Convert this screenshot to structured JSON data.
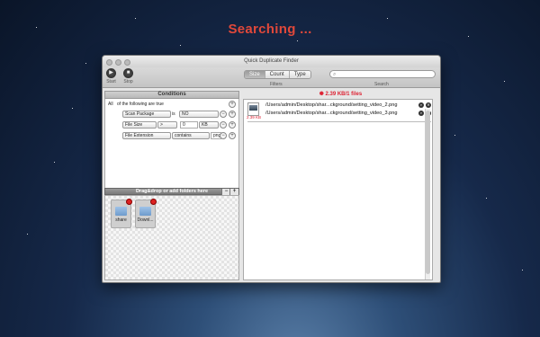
{
  "headline": "Searching ...",
  "window": {
    "title": "Quick Duplicate Finder",
    "toolbar": {
      "start_label": "Start",
      "stop_label": "Stop",
      "filters_caption": "Filters",
      "search_caption": "Search",
      "tabs": [
        {
          "label": "Size",
          "selected": true
        },
        {
          "label": "Count",
          "selected": false
        },
        {
          "label": "Type",
          "selected": false
        }
      ],
      "search_placeholder": ""
    },
    "conditions": {
      "header": "Conditions",
      "quantifier": "All",
      "suffix": "of the following are true",
      "rows": [
        {
          "field": "Scan Package",
          "operator": "is",
          "value": "NO"
        },
        {
          "field": "File Size",
          "operator": ">",
          "value": "0",
          "unit": "KB"
        },
        {
          "field": "File Extension",
          "operator": "contains",
          "value": "png"
        }
      ]
    },
    "drop_area": {
      "label": "Drag&drop or add folders here",
      "minus": "−",
      "plus": "+",
      "folders": [
        {
          "label": "share"
        },
        {
          "label": "Downl..."
        }
      ]
    },
    "results": {
      "summary": "2.39 KB/1 files",
      "group_size": "2.39 KB",
      "files": [
        "/Users/admin/Desktop/shar...ckground/setting_video_2.png",
        "/Users/admin/Desktop/shar...ckground/setting_video_3.png"
      ]
    }
  },
  "colors": {
    "accent": "#e0483a",
    "window_bg": "#e6e6e6"
  }
}
